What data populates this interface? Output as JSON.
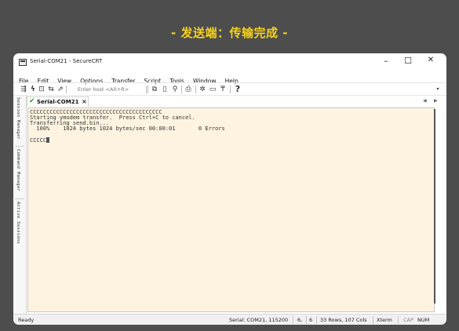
{
  "heading": "- 发送端：传输完成 -",
  "window": {
    "title": "Serial-COM21 - SecureCRT",
    "minimize": "–",
    "maximize": "☐",
    "close": "✕"
  },
  "menu": [
    "File",
    "Edit",
    "View",
    "Options",
    "Transfer",
    "Script",
    "Tools",
    "Window",
    "Help"
  ],
  "toolbar": {
    "host_placeholder": "Enter host <Alt+R>",
    "icons": [
      "connect-icon",
      "lightning-icon",
      "terminal-icon",
      "reconnect-icon",
      "disconnect-icon",
      "copy-icon",
      "paste-icon",
      "find-icon",
      "print-icon",
      "settings-icon",
      "keyboard-icon",
      "keymap-icon",
      "help-icon"
    ]
  },
  "tab": {
    "label": "Serial-COM21",
    "close": "×"
  },
  "sidebar": {
    "session_manager": "Session Manager",
    "command_manager": "Command Manager",
    "active_sessions": "Active Sessions"
  },
  "terminal": {
    "lines": [
      "CCCCCCCCCCCCCCCCCCCCCCCCCCCCCCCCCCCCCCCC",
      "Starting ymodem transfer.  Press Ctrl+C to cancel.",
      "Transferring send.bin...",
      "  100%    1024 bytes 1024 bytes/sec 00:00:01       0 Errors",
      "",
      "CCCCC"
    ]
  },
  "status": {
    "ready": "Ready",
    "serial": "Serial: COM21, 115200",
    "row": "6,",
    "col": "6",
    "size": "33 Rows, 107 Cols",
    "term": "Xterm",
    "cap": "CAP",
    "num": "NUM"
  },
  "colors": {
    "background": "#4d4d4d",
    "heading": "#f5d21c",
    "terminal_bg": "#fdf3e0",
    "tab_check": "#2aa52a"
  }
}
